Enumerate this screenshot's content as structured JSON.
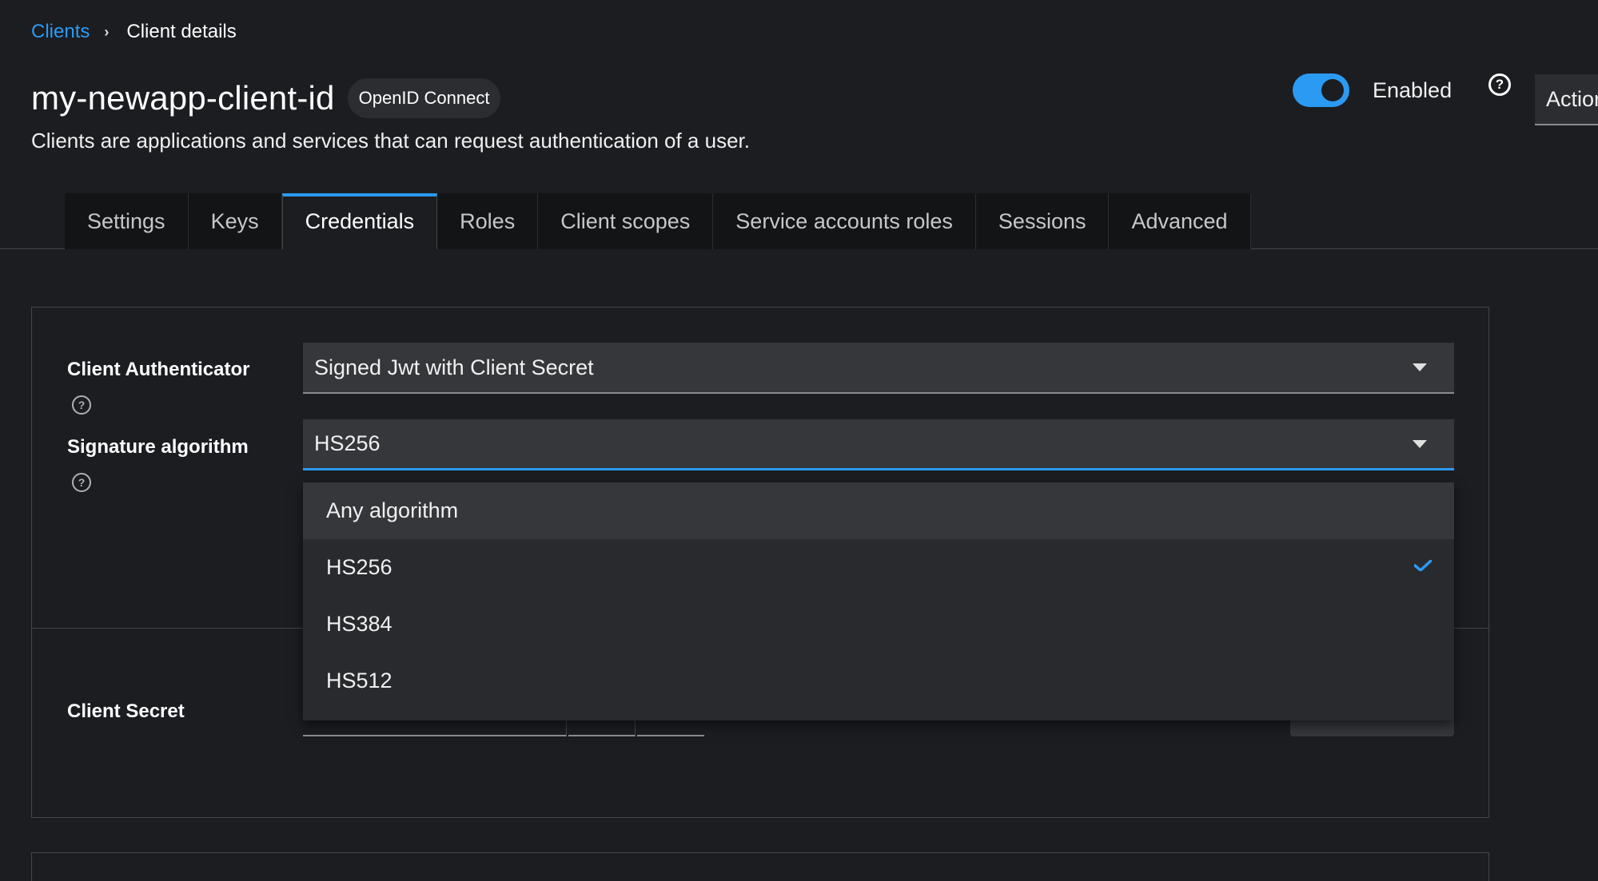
{
  "breadcrumb": {
    "parent": "Clients",
    "current": "Client details"
  },
  "header": {
    "title": "my-newapp-client-id",
    "badge": "OpenID Connect",
    "description": "Clients are applications and services that can request authentication of a user.",
    "enabled_label": "Enabled",
    "enabled": true,
    "action_label": "Action"
  },
  "tabs": [
    {
      "label": "Settings"
    },
    {
      "label": "Keys"
    },
    {
      "label": "Credentials",
      "active": true
    },
    {
      "label": "Roles"
    },
    {
      "label": "Client scopes"
    },
    {
      "label": "Service accounts roles"
    },
    {
      "label": "Sessions"
    },
    {
      "label": "Advanced"
    }
  ],
  "form": {
    "client_authenticator": {
      "label": "Client Authenticator",
      "value": "Signed Jwt with Client Secret"
    },
    "signature_algorithm": {
      "label": "Signature algorithm",
      "value": "HS256"
    },
    "client_secret": {
      "label": "Client Secret"
    }
  },
  "dropdown": {
    "options": [
      {
        "label": "Any algorithm",
        "selected": false
      },
      {
        "label": "HS256",
        "selected": true
      },
      {
        "label": "HS384",
        "selected": false
      },
      {
        "label": "HS512",
        "selected": false
      }
    ]
  },
  "colors": {
    "accent": "#2b9af3",
    "background": "#1b1d21"
  }
}
